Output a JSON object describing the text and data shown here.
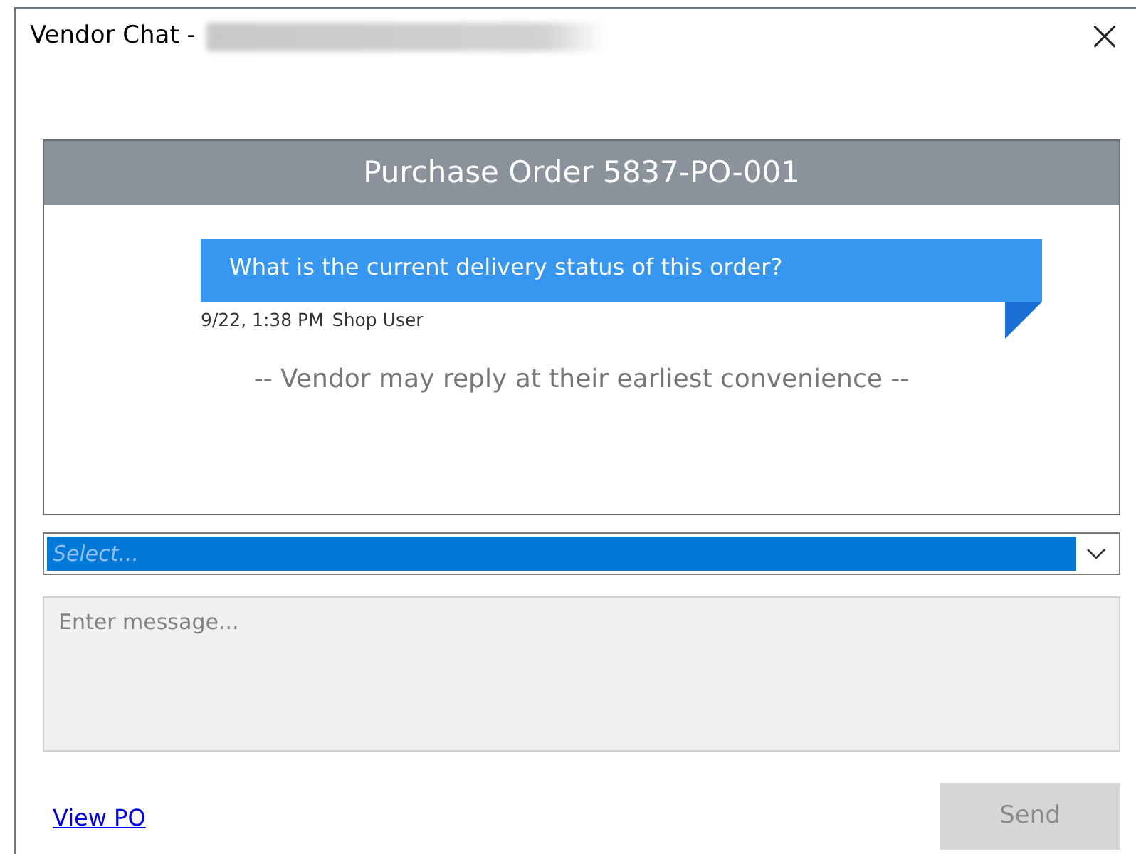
{
  "window": {
    "title": "Vendor Chat -",
    "title_redacted": true,
    "close": "×"
  },
  "chat": {
    "header": "Purchase Order 5837-PO-001",
    "messages": [
      {
        "text": "What is the current delivery status of this order?",
        "time": "9/22, 1:38 PM",
        "author": "Shop User"
      }
    ],
    "notice": "-- Vendor may reply at their earliest convenience --"
  },
  "select": {
    "placeholder": "Select...",
    "highlighted": true
  },
  "message": {
    "placeholder": "Enter message..."
  },
  "link": "View PO",
  "send": {
    "label": "Send",
    "disabled": true
  }
}
